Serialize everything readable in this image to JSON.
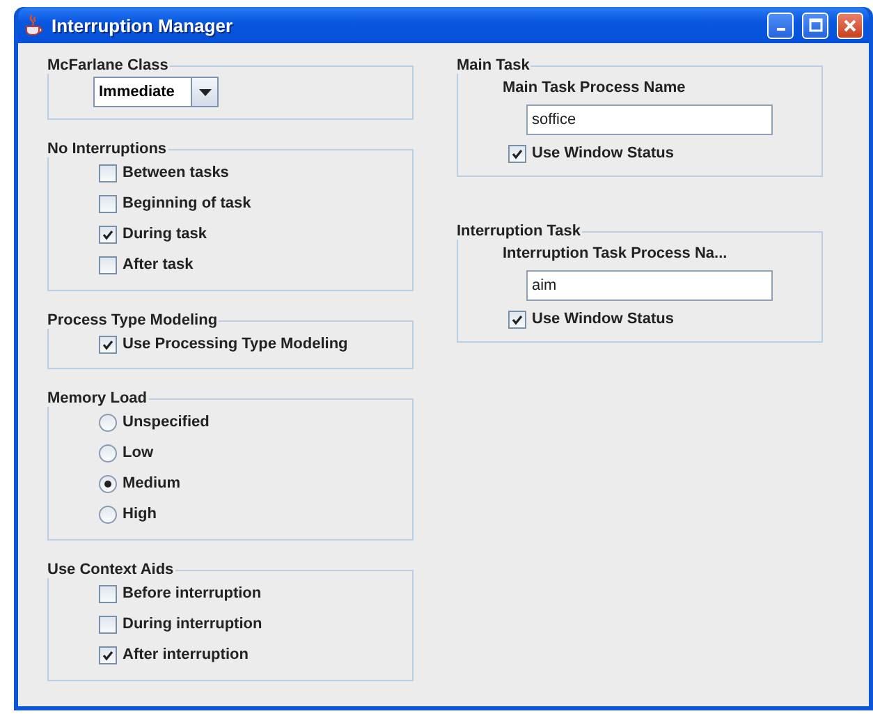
{
  "window": {
    "title": "Interruption Manager"
  },
  "left_groups": [
    {
      "title": "McFarlane Class",
      "kind": "dropdown",
      "value": "Immediate"
    },
    {
      "title": "No Interruptions",
      "kind": "checkboxes",
      "items": [
        {
          "label": "Between tasks",
          "checked": false
        },
        {
          "label": "Beginning of task",
          "checked": false
        },
        {
          "label": "During task",
          "checked": true
        },
        {
          "label": "After task",
          "checked": false
        }
      ]
    },
    {
      "title": "Process Type Modeling",
      "kind": "checkboxes",
      "items": [
        {
          "label": "Use Processing Type Modeling",
          "checked": true
        }
      ]
    },
    {
      "title": "Memory Load",
      "kind": "radios",
      "items": [
        {
          "label": "Unspecified",
          "selected": false
        },
        {
          "label": "Low",
          "selected": false
        },
        {
          "label": "Medium",
          "selected": true
        },
        {
          "label": "High",
          "selected": false
        }
      ]
    },
    {
      "title": "Use Context Aids",
      "kind": "checkboxes",
      "items": [
        {
          "label": "Before interruption",
          "checked": false
        },
        {
          "label": "During interruption",
          "checked": false
        },
        {
          "label": "After interruption",
          "checked": true
        }
      ]
    }
  ],
  "right_groups": [
    {
      "title": "Main Task",
      "field_label": "Main Task Process Name",
      "value": "soffice",
      "option": {
        "label": "Use Window Status",
        "checked": true
      }
    },
    {
      "title": "Interruption Task",
      "field_label": "Interruption Task Process Na...",
      "value": "aim",
      "option": {
        "label": "Use Window Status",
        "checked": true
      }
    }
  ]
}
